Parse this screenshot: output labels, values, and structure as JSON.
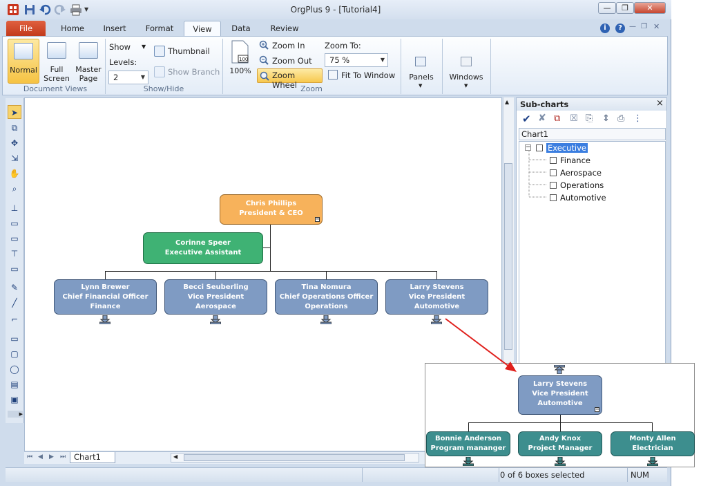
{
  "window": {
    "title": "OrgPlus 9 - [Tutorial4]"
  },
  "ribbon": {
    "tabs": [
      "File",
      "Home",
      "Insert",
      "Format",
      "View",
      "Data",
      "Review"
    ],
    "document_views": {
      "group_label": "Document Views",
      "normal": "Normal",
      "full_screen_1": "Full",
      "full_screen_2": "Screen",
      "master_page_1": "Master",
      "master_page_2": "Page"
    },
    "show_hide": {
      "group_label": "Show/Hide",
      "show": "Show",
      "levels_label": "Levels:",
      "levels_value": "2",
      "thumbnail": "Thumbnail",
      "show_branch": "Show Branch"
    },
    "zoom": {
      "group_label": "Zoom",
      "hundred": "100%",
      "zoom_in": "Zoom In",
      "zoom_out": "Zoom Out",
      "zoom_wheel": "Zoom Wheel",
      "zoom_to_label": "Zoom To:",
      "zoom_to_value": "75 %",
      "fit_to_window": "Fit To Window"
    },
    "panels": "Panels",
    "windows": "Windows"
  },
  "org_chart": {
    "ceo": {
      "name": "Chris  Phillips",
      "title": "President & CEO"
    },
    "assistant": {
      "name": "Corinne  Speer",
      "title": "Executive Assistant"
    },
    "reports": [
      {
        "name": "Lynn  Brewer",
        "title": "Chief Financial Officer",
        "dept": "Finance"
      },
      {
        "name": "Becci  Seuberling",
        "title": "Vice President",
        "dept": "Aerospace"
      },
      {
        "name": "Tina  Nomura",
        "title": "Chief Operations Officer",
        "dept": "Operations"
      },
      {
        "name": "Larry  Stevens",
        "title": "Vice President",
        "dept": "Automotive"
      }
    ]
  },
  "sub_chart_inset": {
    "head": {
      "name": "Larry  Stevens",
      "title": "Vice President",
      "dept": "Automotive"
    },
    "reports": [
      {
        "name": "Bonnie  Anderson",
        "title": "Program mananger"
      },
      {
        "name": "Andy  Knox",
        "title": "Project Manager"
      },
      {
        "name": "Monty  Allen",
        "title": "Electrician"
      }
    ]
  },
  "subcharts_panel": {
    "title": "Sub-charts",
    "close": "×",
    "chart_name": "Chart1",
    "tree": {
      "root": "Executive",
      "children": [
        "Finance",
        "Aerospace",
        "Operations",
        "Automotive"
      ]
    }
  },
  "sheet_tab": "Chart1",
  "status": {
    "selection": "0 of 6 boxes selected",
    "num": "NUM"
  },
  "colors": {
    "ceo_box": "#f7b25b",
    "assistant_box": "#3fb274",
    "report_box": "#7f9bc3",
    "subreport_box": "#3d8e8e",
    "arrow": "#e0201c"
  }
}
